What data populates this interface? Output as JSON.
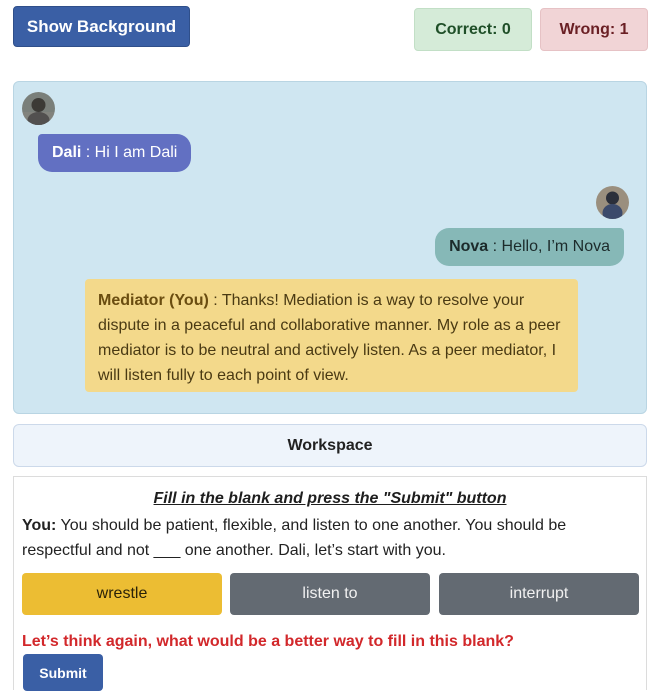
{
  "header": {
    "show_background_label": "Show Background",
    "correct_label": "Correct: 0",
    "wrong_label": "Wrong: 1"
  },
  "chat": {
    "messages": [
      {
        "speaker": "Dali",
        "text": " : Hi I am Dali",
        "avatar_icon": "dali-avatar-icon"
      },
      {
        "speaker": "Nova",
        "text": " : Hello, I’m Nova",
        "avatar_icon": "nova-avatar-icon"
      },
      {
        "speaker": "Mediator (You)",
        "text": " : Thanks! Mediation is a way to resolve your dispute in a peaceful and collaborative manner. My role as a peer mediator is to be neutral and actively listen. As a peer mediator, I will listen fully to each point of view."
      }
    ]
  },
  "workspace": {
    "title": "Workspace"
  },
  "exercise": {
    "instruction": "Fill in the blank and press the \"Submit\" button",
    "question_speaker": "You:",
    "question_text": " You should be patient, flexible, and listen to one another. You should be respectful and not ___ one another. Dali, let’s start with you.",
    "options": [
      "wrestle",
      "listen to",
      "interrupt"
    ],
    "selected_option": "wrestle",
    "feedback": "Let’s think again, what would be a better way to fill in this blank?",
    "submit_label": "Submit"
  },
  "colors": {
    "primary": "#3a5fa5",
    "dali_bubble": "#6270c2",
    "nova_bubble": "#86b8b7",
    "mediator_bubble": "#f3d98b",
    "selected_option": "#ecbd33",
    "feedback": "#d2282b"
  }
}
